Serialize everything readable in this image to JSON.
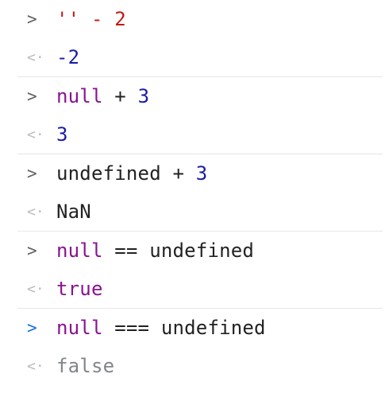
{
  "console": {
    "entries": [
      {
        "input_parts": [
          {
            "text": "'' - 2",
            "kind": "mixed"
          }
        ],
        "output": "-2"
      },
      {
        "input_parts": [
          {
            "text": "null",
            "kind": "keyword"
          },
          {
            "text": " + ",
            "kind": "plain"
          },
          {
            "text": "3",
            "kind": "number"
          }
        ],
        "output": "3"
      },
      {
        "input_parts": [
          {
            "text": "undefined",
            "kind": "plain"
          },
          {
            "text": " + ",
            "kind": "plain"
          },
          {
            "text": "3",
            "kind": "number"
          }
        ],
        "output": "NaN"
      },
      {
        "input_parts": [
          {
            "text": "null",
            "kind": "keyword"
          },
          {
            "text": " == ",
            "kind": "plain"
          },
          {
            "text": "undefined",
            "kind": "plain"
          }
        ],
        "output": "true"
      },
      {
        "input_parts": [
          {
            "text": "null",
            "kind": "keyword"
          },
          {
            "text": " === ",
            "kind": "plain"
          },
          {
            "text": "undefined",
            "kind": "plain"
          }
        ],
        "output": "false"
      }
    ],
    "prompt_symbol": ">",
    "result_symbol": "<·"
  }
}
